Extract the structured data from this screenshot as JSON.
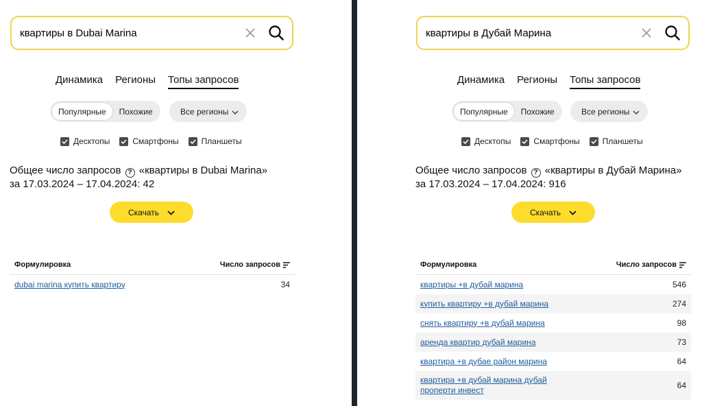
{
  "left": {
    "query": "квартиры в Dubai Marina",
    "tabs": [
      "Динамика",
      "Регионы",
      "Топы запросов"
    ],
    "segment": [
      "Популярные",
      "Похожие"
    ],
    "regions": "Все регионы",
    "devices": [
      "Десктопы",
      "Смартфоны",
      "Планшеты"
    ],
    "total_line1": "Общее число запросов",
    "total_query": "«квартиры в Dubai Marina»",
    "total_line2": "за 17.03.2024 – 17.04.2024: 42",
    "download": "Скачать",
    "col_phrase": "Формулировка",
    "col_count": "Число запросов",
    "rows": [
      {
        "phrase": "dubai marina купить квартиру",
        "count": "34"
      }
    ]
  },
  "right": {
    "query": "квартиры в Дубай Марина",
    "tabs": [
      "Динамика",
      "Регионы",
      "Топы запросов"
    ],
    "segment": [
      "Популярные",
      "Похожие"
    ],
    "regions": "Все регионы",
    "devices": [
      "Десктопы",
      "Смартфоны",
      "Планшеты"
    ],
    "total_line1": "Общее число запросов",
    "total_query": "«квартиры в Дубай Марина»",
    "total_line2": "за 17.03.2024 – 17.04.2024: 916",
    "download": "Скачать",
    "col_phrase": "Формулировка",
    "col_count": "Число запросов",
    "rows": [
      {
        "phrase": "квартиры +в дубай марина",
        "count": "546"
      },
      {
        "phrase": "купить квартиру +в дубай марина",
        "count": "274"
      },
      {
        "phrase": "снять квартиру +в дубай марина",
        "count": "98"
      },
      {
        "phrase": "аренда квартир дубай марина",
        "count": "73"
      },
      {
        "phrase": "квартира +в дубае район марина",
        "count": "64"
      },
      {
        "phrase": "квартира +в дубай марина дубай проперти инвест",
        "count": "64"
      }
    ]
  },
  "icons": {
    "clear": "close-icon",
    "search": "search-icon",
    "help": "question-circle-icon",
    "chevron": "chevron-down-icon",
    "checkbox": "checkmark-icon",
    "sort": "sort-icon"
  },
  "colors": {
    "search_border": "#f3d24a",
    "download_bg": "#fddc2c",
    "link": "#1f5b9b",
    "divider": "#1f2430"
  }
}
